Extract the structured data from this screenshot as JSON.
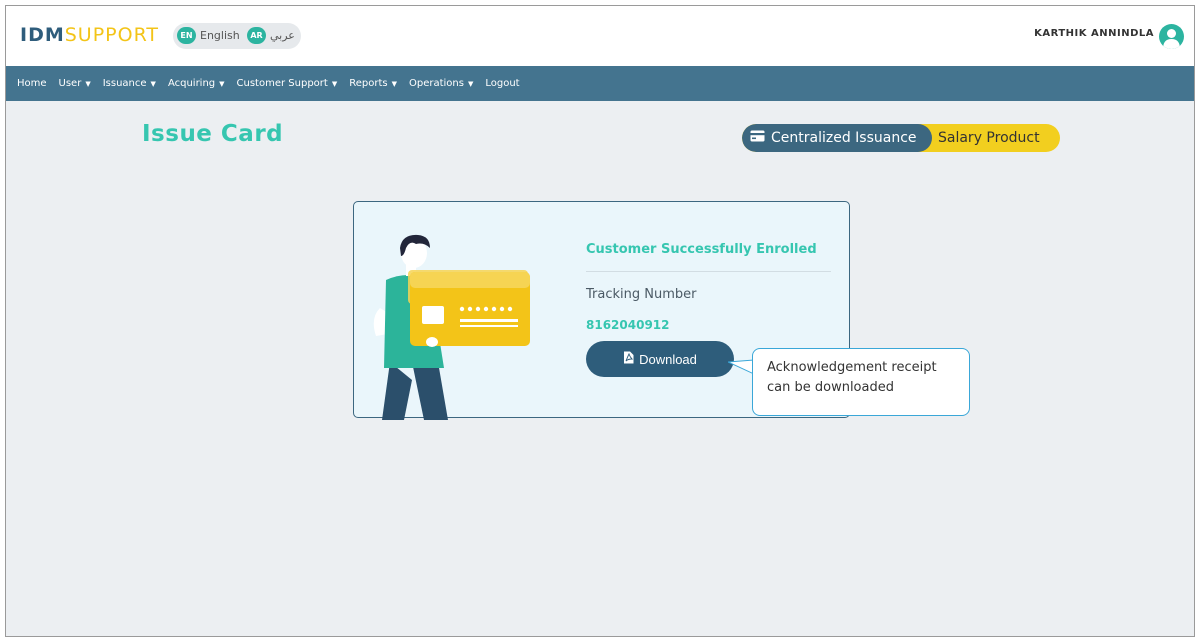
{
  "header": {
    "logo_primary": "IDM",
    "logo_secondary": "SUPPORT",
    "lang_en_badge": "EN",
    "lang_en_label": "English",
    "lang_ar_badge": "AR",
    "lang_ar_label": "عربي",
    "user_name": "KARTHIK ANNINDLA"
  },
  "nav": {
    "items": [
      {
        "label": "Home",
        "dropdown": false
      },
      {
        "label": "User",
        "dropdown": true
      },
      {
        "label": "Issuance",
        "dropdown": true
      },
      {
        "label": "Acquiring",
        "dropdown": true
      },
      {
        "label": "Customer Support",
        "dropdown": true
      },
      {
        "label": "Reports",
        "dropdown": true
      },
      {
        "label": "Operations",
        "dropdown": true
      },
      {
        "label": "Logout",
        "dropdown": false
      }
    ],
    "caret": "▼"
  },
  "page": {
    "title": "Issue Card",
    "product_selected": "Centralized Issuance",
    "product_other": "Salary Product"
  },
  "result": {
    "status": "Customer Successfully Enrolled",
    "tracking_label": "Tracking Number",
    "tracking_number": "8162040912",
    "download_label": "Download"
  },
  "callout": {
    "line1": "Acknowledgement receipt",
    "line2": "can be downloaded"
  },
  "colors": {
    "accent": "#36c6b0",
    "navbar": "#44748f",
    "button": "#2e5d7b",
    "yellow": "#f2cf1f"
  },
  "icons": {
    "pill": "credit-card-icon",
    "download": "pdf-file-icon",
    "avatar": "user-avatar-icon"
  }
}
